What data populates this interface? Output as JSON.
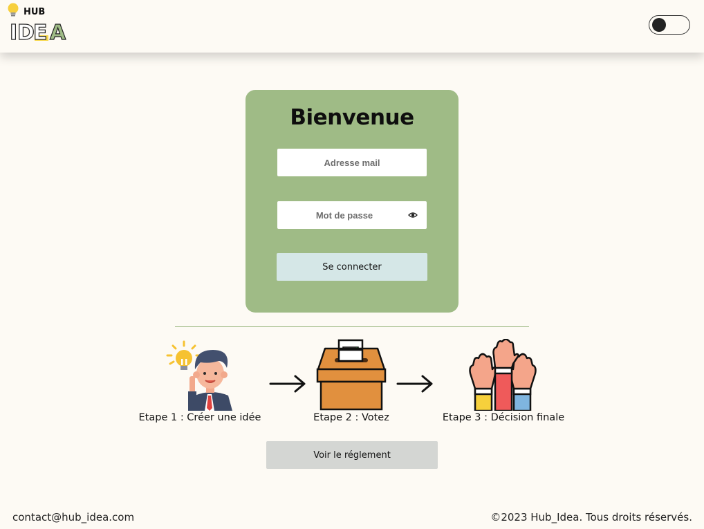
{
  "header": {
    "logo_small_text": "HUB",
    "logo_big_text": "IDEA",
    "theme_toggle_state": "off"
  },
  "login": {
    "title": "Bienvenue",
    "email_placeholder": "Adresse mail",
    "password_placeholder": "Mot de passe",
    "submit_label": "Se connecter"
  },
  "steps": [
    {
      "label": "Etape 1 : Créer une idée",
      "icon": "idea-person-icon"
    },
    {
      "label": "Etape 2 : Votez",
      "icon": "ballot-box-icon"
    },
    {
      "label": "Etape 3 : Décision finale",
      "icon": "raised-hands-icon"
    }
  ],
  "rules_button_label": "Voir le réglement",
  "footer": {
    "contact": "contact@hub_idea.com",
    "copyright": "©2023 Hub_Idea. Tous droits réservés."
  },
  "colors": {
    "background": "#fdfaf4",
    "card": "#9fbb86",
    "login_button": "#d5e7e7",
    "rules_button": "#d4d6d3"
  }
}
